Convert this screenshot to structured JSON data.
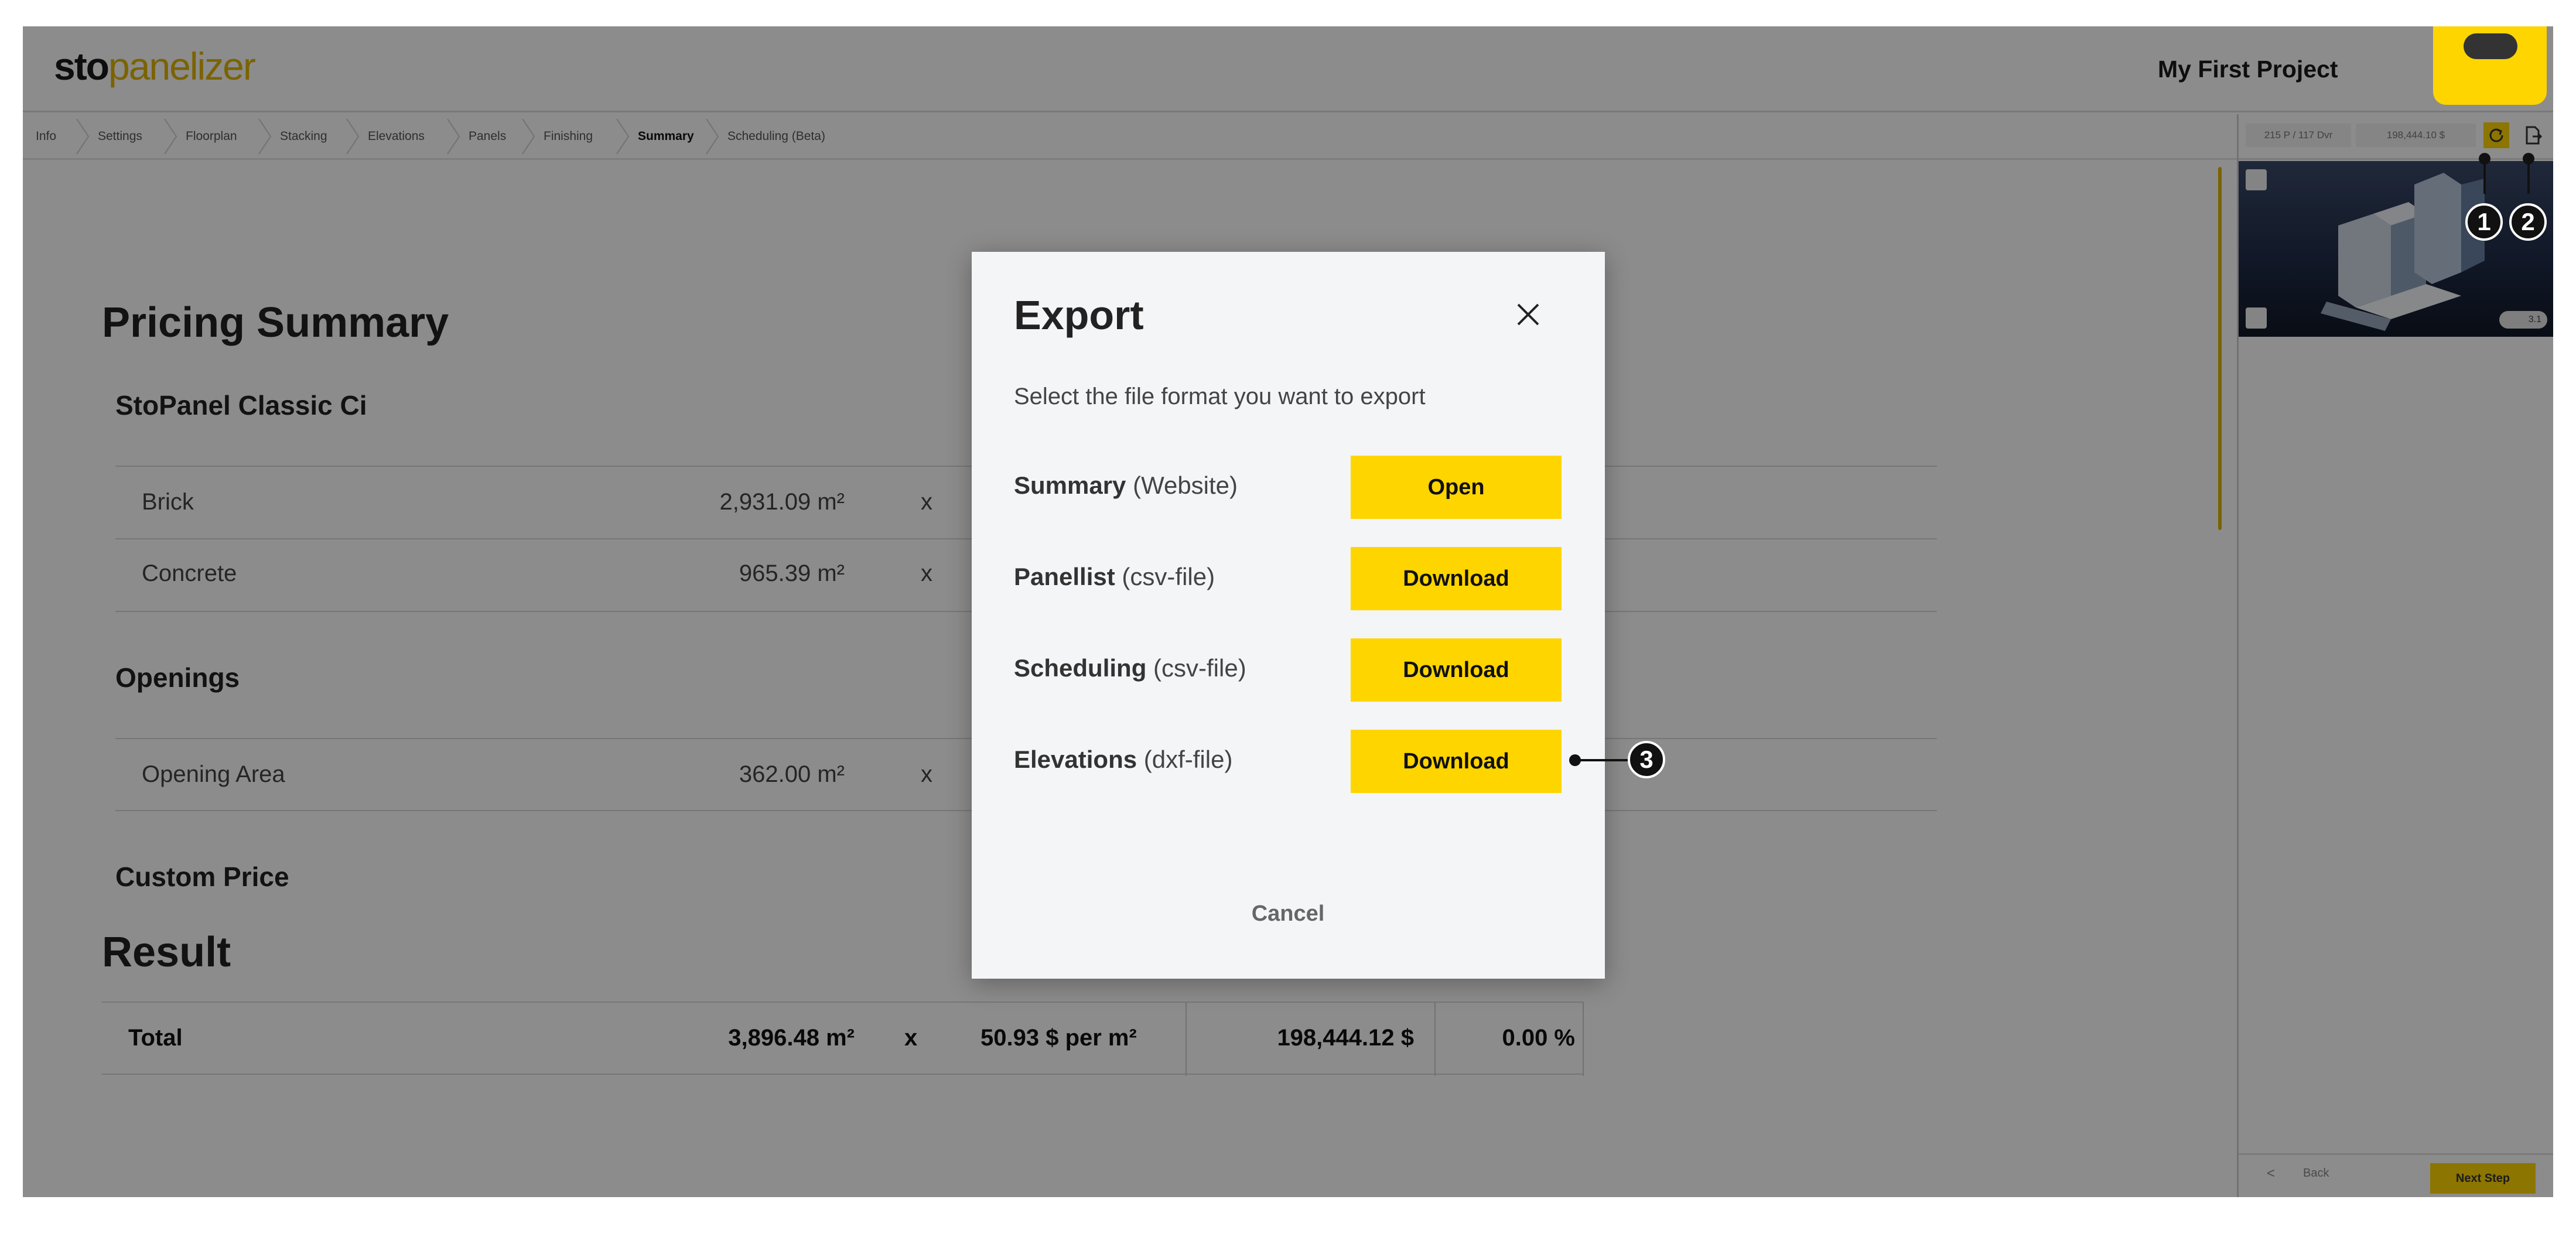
{
  "app": {
    "logo_sto": "sto",
    "logo_panelizer": "panelizer",
    "project_title": "My First Project"
  },
  "breadcrumb": [
    {
      "label": "Info"
    },
    {
      "label": "Settings"
    },
    {
      "label": "Floorplan"
    },
    {
      "label": "Stacking"
    },
    {
      "label": "Elevations"
    },
    {
      "label": "Panels"
    },
    {
      "label": "Finishing"
    },
    {
      "label": "Summary",
      "active": true
    },
    {
      "label": "Scheduling (Beta)"
    }
  ],
  "pricing": {
    "title": "Pricing Summary",
    "system_title": "StoPanel Classic Ci",
    "rows": [
      {
        "label": "Brick",
        "area": "2,931.09 m²",
        "x": "x"
      },
      {
        "label": "Concrete",
        "area": "965.39 m²",
        "x": "x"
      }
    ],
    "openings_title": "Openings",
    "openings_rows": [
      {
        "label": "Opening Area",
        "area": "362.00 m²",
        "x": "x"
      }
    ],
    "custom_price_title": "Custom Price",
    "result_title": "Result",
    "total": {
      "label": "Total",
      "area": "3,896.48 m²",
      "x": "x",
      "unit_price": "50.93 $ per m²",
      "price": "198,444.12 $",
      "percent": "0.00 %"
    }
  },
  "sidebar": {
    "stats": "215 P / 117 Dvr",
    "price": "198,444.10 $",
    "viewer_badge": "3.1",
    "back_label": "Back",
    "next_label": "Next Step"
  },
  "modal": {
    "title": "Export",
    "description": "Select the file format you want to export",
    "options": [
      {
        "name": "Summary",
        "type": "(Website)",
        "button": "Open"
      },
      {
        "name": "Panellist",
        "type": "(csv-file)",
        "button": "Download"
      },
      {
        "name": "Scheduling",
        "type": "(csv-file)",
        "button": "Download"
      },
      {
        "name": "Elevations",
        "type": "(dxf-file)",
        "button": "Download"
      }
    ],
    "cancel_label": "Cancel"
  },
  "callouts": {
    "one": "1",
    "two": "2",
    "three": "3"
  },
  "colors": {
    "accent": "#ffd500",
    "overlay": "#000000"
  }
}
